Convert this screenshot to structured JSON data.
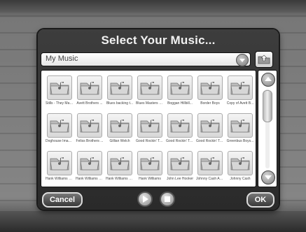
{
  "dialog": {
    "title": "Select Your Music...",
    "folder_select": {
      "value": "My Music"
    },
    "buttons": {
      "cancel": "Cancel",
      "ok": "OK"
    }
  },
  "grid": {
    "items": [
      {
        "label": "Stills - They Mak..."
      },
      {
        "label": "Avett Brothers ..."
      },
      {
        "label": "Blues backing t..."
      },
      {
        "label": "Blues Masters V..."
      },
      {
        "label": "Boggan Hillbill..."
      },
      {
        "label": "Border Boys"
      },
      {
        "label": "Copy of Avett B..."
      },
      {
        "label": "Doghouse Imagi..."
      },
      {
        "label": "Feliss Brothers ..."
      },
      {
        "label": "Gillian Welch"
      },
      {
        "label": "Good Rockin' To..."
      },
      {
        "label": "Good Rockin' To..."
      },
      {
        "label": "Good Rockin' To..."
      },
      {
        "label": "Greenbus Boys..."
      },
      {
        "label": "Hank Williams U..."
      },
      {
        "label": "Hank Williams U..."
      },
      {
        "label": "Hank Williams U..."
      },
      {
        "label": "Hank Williams"
      },
      {
        "label": "John Lee Hooker"
      },
      {
        "label": "Johnny Cash Am..."
      },
      {
        "label": "Johnny Cash"
      }
    ]
  },
  "icons": {
    "folder": "folder-music-icon",
    "dropdown": "chevron-down-icon",
    "up_folder": "folder-up-icon",
    "play": "play-icon",
    "stop": "stop-icon",
    "scroll_up": "scroll-up-icon",
    "scroll_down": "scroll-down-icon"
  }
}
